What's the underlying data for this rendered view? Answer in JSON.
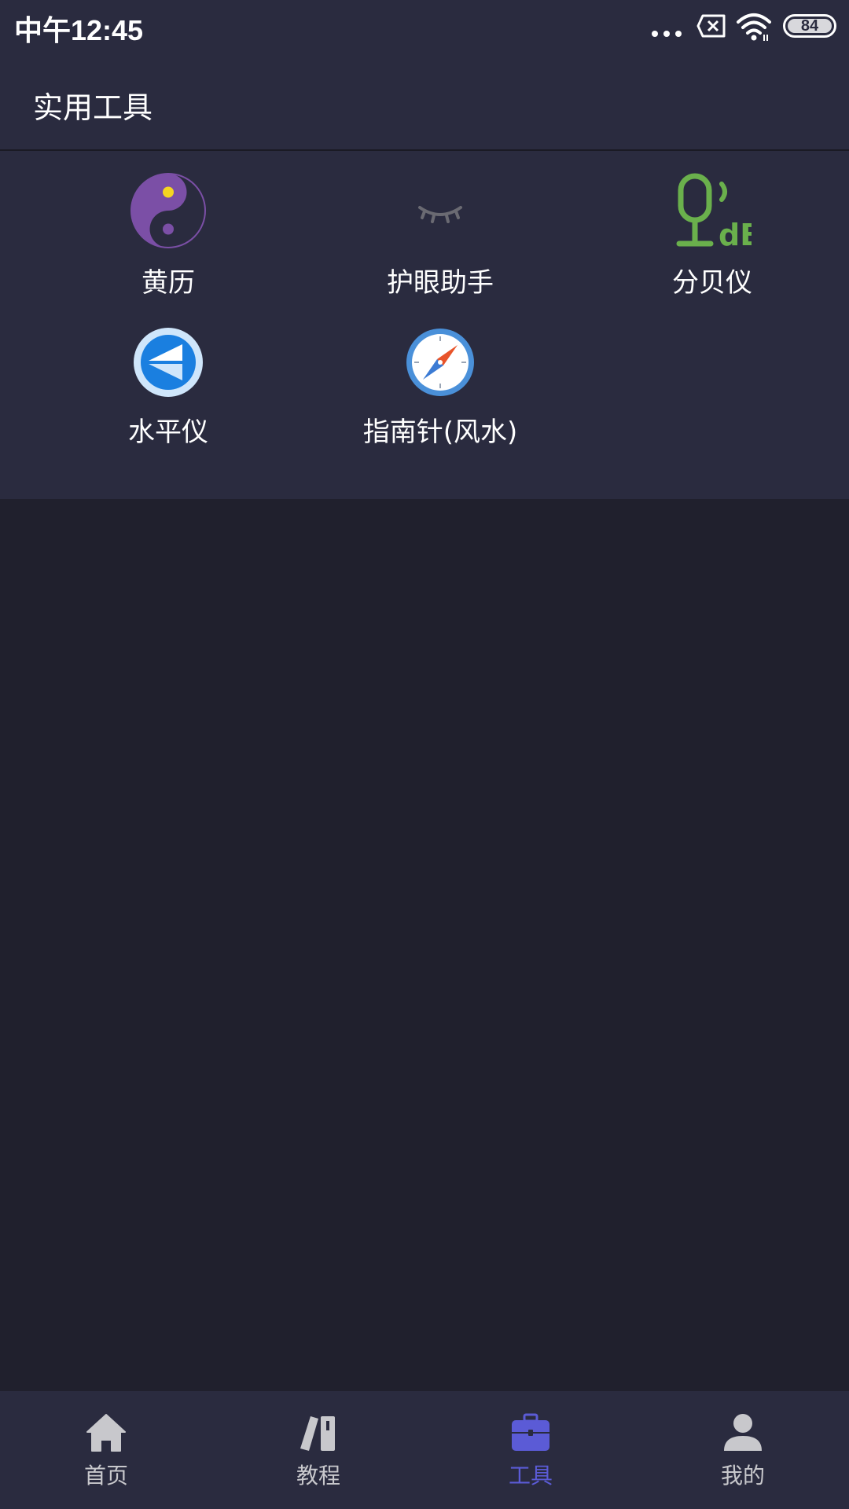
{
  "status_bar": {
    "time": "中午12:45",
    "battery": "84"
  },
  "header": {
    "title": "实用工具"
  },
  "tools": [
    {
      "label": "黄历",
      "icon": "yin-yang-icon",
      "color": "#7b4fa6"
    },
    {
      "label": "护眼助手",
      "icon": "closed-eye-icon",
      "color": "#6a6a72"
    },
    {
      "label": "分贝仪",
      "icon": "microphone-db-icon",
      "color": "#6ab04c"
    },
    {
      "label": "水平仪",
      "icon": "level-icon",
      "color": "#1a7fe0"
    },
    {
      "label": "指南针(风水)",
      "icon": "compass-icon",
      "color": "#4a90d9"
    }
  ],
  "bottom_nav": {
    "items": [
      {
        "label": "首页",
        "icon": "home-icon"
      },
      {
        "label": "教程",
        "icon": "books-icon"
      },
      {
        "label": "工具",
        "icon": "toolbox-icon"
      },
      {
        "label": "我的",
        "icon": "person-icon"
      }
    ],
    "active_index": 2,
    "active_color": "#5b5bd6",
    "inactive_color": "#c8c8cc"
  },
  "colors": {
    "panel_background": "#2a2b3f",
    "page_background": "#20202d"
  }
}
